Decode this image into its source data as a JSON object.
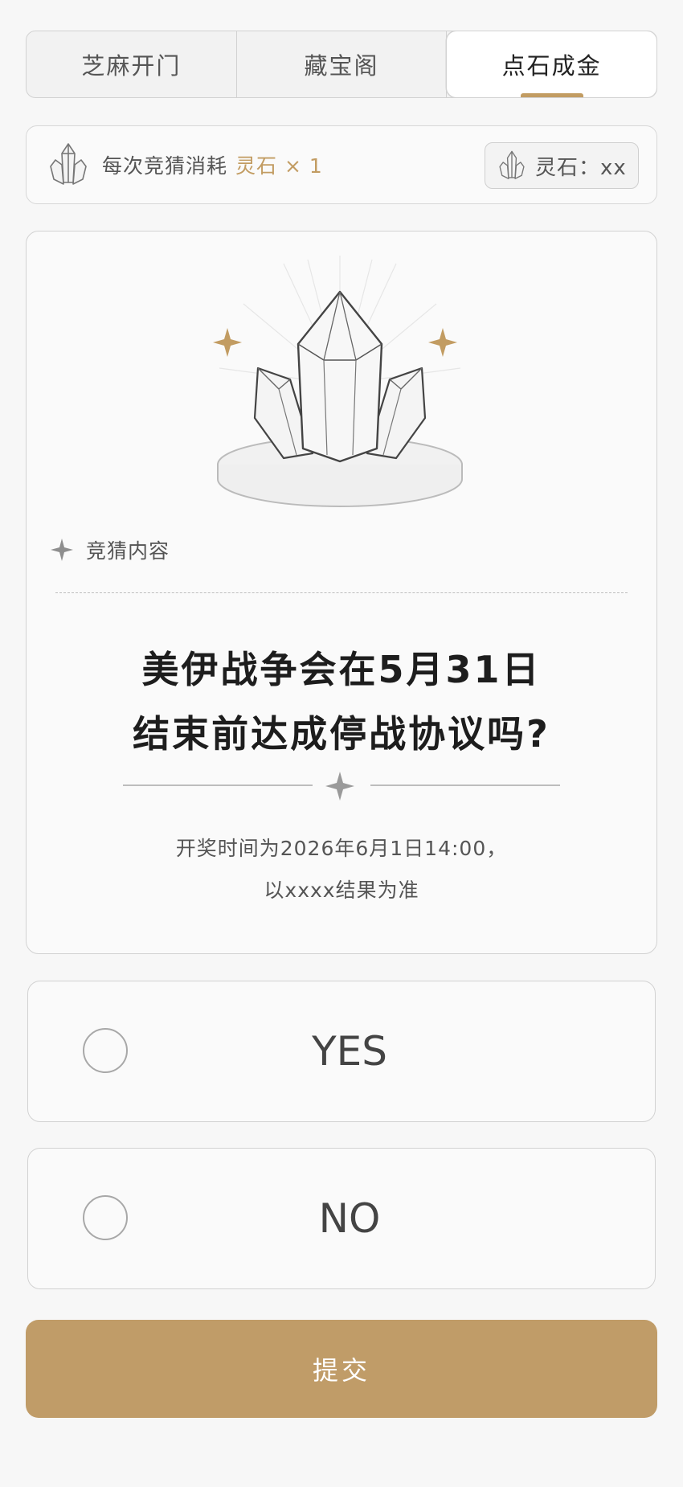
{
  "tabs": [
    {
      "label": "芝麻开门",
      "active": false
    },
    {
      "label": "藏宝阁",
      "active": false
    },
    {
      "label": "点石成金",
      "active": true
    }
  ],
  "cost": {
    "prefix": "每次竞猜消耗",
    "item": "灵石 × 1",
    "icon": "crystal-icon"
  },
  "balance": {
    "label": "灵石：xx",
    "icon": "crystal-icon"
  },
  "card": {
    "section_label": "竞猜内容",
    "question_lines": [
      "美伊战争会在5月31日",
      "结束前达成停战协议吗?"
    ],
    "info_lines": [
      "开奖时间为2026年6月1日14:00，",
      "以xxxx结果为准"
    ]
  },
  "options": [
    {
      "label": "YES",
      "selected": false
    },
    {
      "label": "NO",
      "selected": false
    }
  ],
  "submit_label": "提交",
  "colors": {
    "accent": "#c29c62",
    "submit": "#c09c68",
    "background": "#f7f7f7",
    "border": "#d2d2d2"
  }
}
